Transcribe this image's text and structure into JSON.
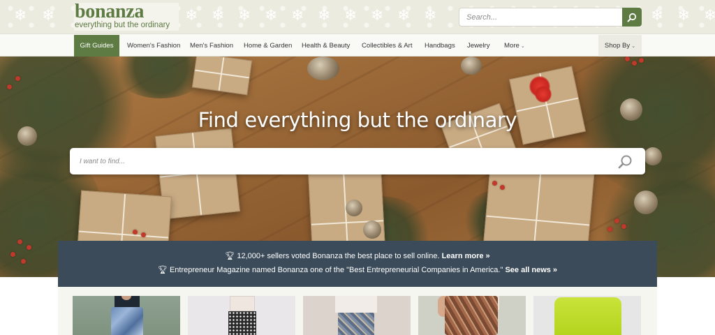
{
  "header": {
    "logo_name": "bonanza",
    "logo_tagline": "everything but the ordinary",
    "search_placeholder": "Search...",
    "search_icon": "search-icon"
  },
  "nav": {
    "items": [
      {
        "label": "Gift Guides",
        "active": true
      },
      {
        "label": "Women's Fashion"
      },
      {
        "label": "Men's Fashion"
      },
      {
        "label": "Home & Garden"
      },
      {
        "label": "Health & Beauty"
      },
      {
        "label": "Collectibles & Art"
      },
      {
        "label": "Handbags"
      },
      {
        "label": "Jewelry"
      },
      {
        "label": "More",
        "dropdown": true
      }
    ],
    "shop_by": {
      "label": "Shop By",
      "dropdown": true
    }
  },
  "hero": {
    "title": "Find everything but the ordinary",
    "search_placeholder": "I want to find...",
    "search_icon": "search-icon"
  },
  "announcements": [
    {
      "icon": "trophy-icon",
      "text": "12,000+ sellers voted Bonanza the best place to sell online.",
      "link": "Learn more »"
    },
    {
      "icon": "trophy-icon",
      "text": "Entrepreneur Magazine named Bonanza one of the \"Best Entrepreneurial Companies in America.\"",
      "link": "See all news »"
    }
  ],
  "colors": {
    "brand_green": "#5d7b43",
    "header_bg": "#ecebdf",
    "announce_bg": "#3b4b59"
  },
  "products": [
    {
      "name": "product-sequin-skirt"
    },
    {
      "name": "product-polka-dot-skirt"
    },
    {
      "name": "product-floral-shorts"
    },
    {
      "name": "product-floral-skirt"
    },
    {
      "name": "product-lime-skirt"
    }
  ]
}
